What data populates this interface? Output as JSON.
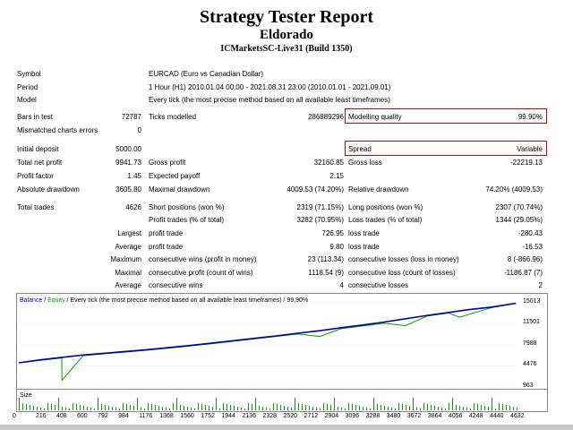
{
  "header": {
    "title": "Strategy Tester Report",
    "ea": "Eldorado",
    "server": "ICMarketsSC-Live31 (Build 1350)"
  },
  "info": {
    "symbol_label": "Symbol",
    "symbol": "EURCAD (Euro vs Canadian Dollar)",
    "period_label": "Period",
    "period": "1 Hour (H1) 2010.01.04 00:00 - 2021.08.31 23:00 (2010.01.01 - 2021.09.01)",
    "model_label": "Model",
    "model": "Every tick (the most precise method based on all available least timeframes)"
  },
  "stats": {
    "bars_label": "Bars in test",
    "bars": "72787",
    "ticks_label": "Ticks modelled",
    "ticks": "286889296",
    "mq_label": "Modelling quality",
    "mq": "99.90%",
    "mismatch_label": "Mismatched charts errors",
    "mismatch": "0",
    "deposit_label": "Initial deposit",
    "deposit": "5000.00",
    "spread_label": "Spread",
    "spread": "Variable",
    "netprofit_label": "Total net profit",
    "netprofit": "9941.73",
    "grossprofit_label": "Gross profit",
    "grossprofit": "32160.85",
    "grossloss_label": "Gross loss",
    "grossloss": "-22219.13",
    "pf_label": "Profit factor",
    "pf": "1.45",
    "ep_label": "Expected payoff",
    "ep": "2.15",
    "absdd_label": "Absolute drawdown",
    "absdd": "3605.80",
    "maxdd_label": "Maximal drawdown",
    "maxdd": "4009.53 (74.20%)",
    "reldd_label": "Relative drawdown",
    "reldd": "74.20% (4009.53)",
    "trades_label": "Total trades",
    "trades": "4626",
    "short_label": "Short positions (won %)",
    "short": "2319 (71.15%)",
    "long_label": "Long positions (won %)",
    "long": "2307 (70.74%)",
    "pt_label": "Profit trades (% of total)",
    "pt": "3282 (70.95%)",
    "lt_label": "Loss trades (% of total)",
    "lt": "1344 (29.05%)",
    "largest_label": "Largest",
    "lpt_label": "profit trade",
    "lpt": "726.95",
    "llt_label": "loss trade",
    "llt": "-280.43",
    "average_label": "Average",
    "apt_label": "profit trade",
    "apt": "9.80",
    "alt_label": "loss trade",
    "alt": "-16.53",
    "maximum_label": "Maximum",
    "mcw_label": "consecutive wins (profit in money)",
    "mcw": "23 (113.34)",
    "mcl_label": "consecutive losses (loss in money)",
    "mcl": "8 (-866.96)",
    "maximal_label": "Maximal",
    "mcp_label": "consecutive profit (count of wins)",
    "mcp": "1118.54 (9)",
    "mcll_label": "consecutive loss (count of losses)",
    "mcll": "-1186.87 (7)",
    "average2_label": "Average",
    "acw_label": "consecutive wins",
    "acw": "4",
    "acl_label": "consecutive losses",
    "acl": "2"
  },
  "chart_data": {
    "type": "line",
    "legend_balance": "Balance",
    "legend_sep": " / ",
    "legend_equity": "Equity",
    "legend_rest": " / Every tick (the most precise method based on all available least timeframes) / 99.90%",
    "ylim": [
      963,
      15013
    ],
    "y_ticks": [
      "15013",
      "11501",
      "7988",
      "4476",
      "963"
    ],
    "x_ticks": [
      "0",
      "216",
      "408",
      "600",
      "792",
      "984",
      "1176",
      "1368",
      "1560",
      "1752",
      "1944",
      "2136",
      "2328",
      "2520",
      "2712",
      "2904",
      "3096",
      "3288",
      "3480",
      "3672",
      "3864",
      "4056",
      "4248",
      "4440",
      "4632"
    ],
    "volume_label": "Size",
    "series": [
      {
        "name": "Balance",
        "color": "#0000b0",
        "x": [
          0,
          200,
          400,
          600,
          800,
          1000,
          1200,
          1400,
          1600,
          1800,
          2000,
          2200,
          2400,
          2600,
          2800,
          3000,
          3200,
          3400,
          3600,
          3800,
          4000,
          4200,
          4400,
          4626
        ],
        "values": [
          5000,
          5500,
          5900,
          6300,
          6600,
          6900,
          7200,
          7550,
          7900,
          8300,
          8700,
          9100,
          9500,
          9950,
          10350,
          10850,
          11300,
          11800,
          12350,
          12900,
          13400,
          13900,
          14300,
          14941
        ]
      },
      {
        "name": "Equity",
        "color": "#00a000",
        "x": [
          0,
          200,
          400,
          402,
          600,
          1000,
          1400,
          1800,
          2200,
          2600,
          2800,
          3000,
          3400,
          3600,
          3800,
          4000,
          4100,
          4400,
          4626
        ],
        "values": [
          5000,
          5400,
          5800,
          2100,
          6200,
          6800,
          7450,
          8200,
          9000,
          9800,
          9400,
          10700,
          11600,
          11200,
          12800,
          13300,
          12600,
          14200,
          14900
        ]
      }
    ]
  },
  "colors": {
    "accent_box": "#d00000",
    "balance": "#0000b0",
    "equity": "#00a000"
  }
}
